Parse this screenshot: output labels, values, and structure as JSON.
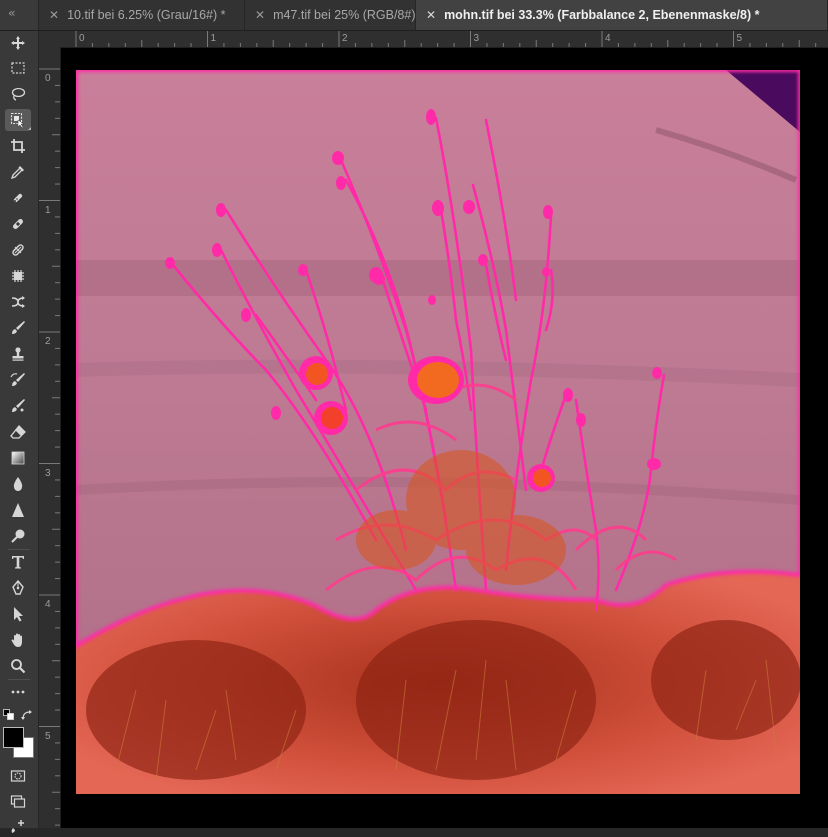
{
  "tabs": [
    {
      "close_glyph": "✕",
      "label": "10.tif bei 6.25% (Grau/16#) *",
      "active": false
    },
    {
      "close_glyph": "✕",
      "label": "m47.tif bei 25% (RGB/8#)",
      "active": false
    },
    {
      "close_glyph": "✕",
      "label": "mohn.tif bei 33.3% (Farbbalance 2, Ebenenmaske/8) *",
      "active": true
    }
  ],
  "toolbar_collapse_glyph": "‹‹",
  "tools": [
    {
      "name": "move-tool",
      "icon": "move-icon"
    },
    {
      "name": "rectangular-marquee-tool",
      "icon": "marquee-icon"
    },
    {
      "name": "lasso-tool",
      "icon": "lasso-icon"
    },
    {
      "name": "object-selection-tool",
      "icon": "object-selection-icon"
    },
    {
      "name": "crop-tool",
      "icon": "crop-icon"
    },
    {
      "name": "eyedropper-tool",
      "icon": "eyedropper-icon"
    },
    {
      "name": "spot-healing-tool",
      "icon": "spot-healing-icon"
    },
    {
      "name": "healing-brush-tool",
      "icon": "bandage-icon"
    },
    {
      "name": "patch-tool",
      "icon": "patch-icon"
    },
    {
      "name": "content-aware-move-tool",
      "icon": "cross-arrows-icon"
    },
    {
      "name": "brush-tool",
      "icon": "brush-icon"
    },
    {
      "name": "clone-stamp-tool",
      "icon": "stamp-icon"
    },
    {
      "name": "history-brush-tool",
      "icon": "history-brush-icon"
    },
    {
      "name": "art-history-brush-tool",
      "icon": "art-brush-icon"
    },
    {
      "name": "eraser-tool",
      "icon": "eraser-icon"
    },
    {
      "name": "gradient-tool",
      "icon": "gradient-icon"
    },
    {
      "name": "blur-tool",
      "icon": "drop-icon"
    },
    {
      "name": "sharpen-tool",
      "icon": "triangle-icon"
    },
    {
      "name": "dodge-tool",
      "icon": "dodge-icon"
    },
    {
      "name": "type-tool",
      "icon": "type-icon"
    },
    {
      "name": "pen-tool",
      "icon": "pen-icon"
    },
    {
      "name": "path-selection-tool",
      "icon": "arrow-icon"
    },
    {
      "name": "hand-tool",
      "icon": "hand-icon"
    },
    {
      "name": "zoom-tool",
      "icon": "zoom-icon"
    },
    {
      "name": "more-tools",
      "icon": "ellipsis-icon"
    }
  ],
  "ruler": {
    "horizontal_labels": [
      "0",
      "1",
      "2",
      "3",
      "4",
      "5"
    ],
    "vertical_labels": [
      "0",
      "1",
      "2",
      "3",
      "4",
      "5"
    ]
  },
  "colors": {
    "foreground": "#000000",
    "background": "#ffffff",
    "mask_overlay": "#e8368f",
    "accent": "#ff2aa8"
  },
  "document": {
    "filename": "mohn.tif",
    "zoom": "33.3%",
    "layer": "Farbbalance 2",
    "mode": "Ebenenmaske/8"
  }
}
